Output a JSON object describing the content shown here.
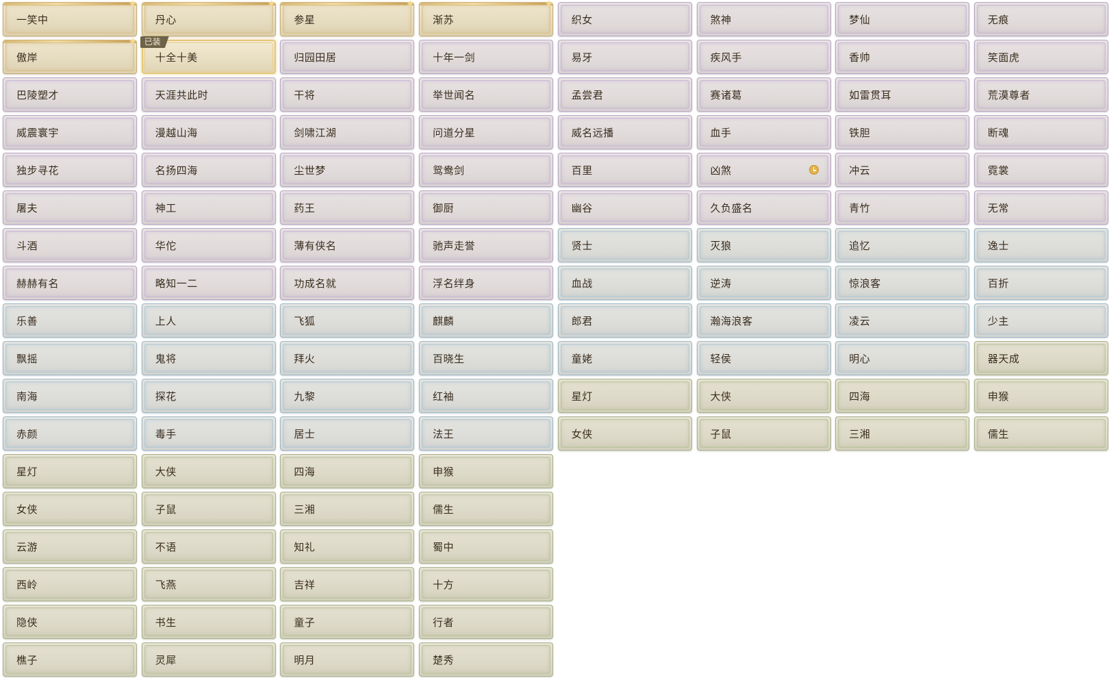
{
  "equipped_badge": "已装",
  "colors": {
    "gold": "#e6dcc0",
    "purple": "#e0dbda",
    "blue": "#dcdcd8",
    "green": "#ddd9c8",
    "text": "#3a2d1e"
  },
  "titles": [
    [
      "一笑中",
      "丹心",
      "参星",
      "渐苏",
      "织女",
      "煞神",
      "梦仙",
      "无痕"
    ],
    [
      "傲岸",
      "十全十美",
      "归园田居",
      "十年一剑",
      "易牙",
      "疾风手",
      "香帅",
      "笑面虎"
    ],
    [
      "巴陵塑才",
      "天涯共此时",
      "干将",
      "举世闻名",
      "孟尝君",
      "赛诸葛",
      "如雷贯耳",
      "荒漠尊者"
    ],
    [
      "威震寰宇",
      "漫越山海",
      "剑啸江湖",
      "问道分星",
      "威名远播",
      "血手",
      "铁胆",
      "断魂"
    ],
    [
      "独步寻花",
      "名扬四海",
      "尘世梦",
      "鸳鸯剑",
      "百里",
      "凶煞",
      "冲云",
      "霓裳"
    ],
    [
      "屠夫",
      "神工",
      "药王",
      "御厨",
      "幽谷",
      "久负盛名",
      "青竹",
      "无常"
    ],
    [
      "斗酒",
      "华佗",
      "薄有侠名",
      "驰声走誉",
      "贤士",
      "灭狼",
      "追忆",
      "逸士"
    ],
    [
      "赫赫有名",
      "略知一二",
      "功成名就",
      "浮名绊身",
      "血战",
      "逆涛",
      "惊浪客",
      "百折"
    ],
    [
      "乐善",
      "上人",
      "飞狐",
      "麒麟",
      "郎君",
      "瀚海浪客",
      "凌云",
      "少主"
    ],
    [
      "飘摇",
      "鬼将",
      "拜火",
      "百晓生",
      "童姥",
      "轻侯",
      "明心",
      "器天成"
    ],
    [
      "南海",
      "探花",
      "九黎",
      "红袖",
      "星灯",
      "大侠",
      "四海",
      "申猴"
    ],
    [
      "赤颜",
      "毒手",
      "居士",
      "法王",
      "女侠",
      "子鼠",
      "三湘",
      "儒生"
    ],
    [
      "星灯",
      "大侠",
      "四海",
      "申猴"
    ],
    [
      "女侠",
      "子鼠",
      "三湘",
      "儒生"
    ],
    [
      "云游",
      "不语",
      "知礼",
      "蜀中"
    ],
    [
      "西岭",
      "飞燕",
      "吉祥",
      "十方"
    ],
    [
      "隐侠",
      "书生",
      "童子",
      "行者"
    ],
    [
      "樵子",
      "灵犀",
      "明月",
      "楚秀"
    ]
  ],
  "rarity": [
    [
      "gold",
      "gold",
      "gold",
      "gold",
      "purple",
      "purple",
      "purple",
      "purple"
    ],
    [
      "gold",
      "gold-eq",
      "purple",
      "purple",
      "purple",
      "purple",
      "purple",
      "purple"
    ],
    [
      "purple",
      "purple",
      "purple",
      "purple",
      "purple",
      "purple",
      "purple",
      "purple"
    ],
    [
      "purple",
      "purple",
      "purple",
      "purple",
      "purple",
      "purple",
      "purple",
      "purple"
    ],
    [
      "purple",
      "purple",
      "purple",
      "purple",
      "purple",
      "purple",
      "purple",
      "purple"
    ],
    [
      "purple",
      "purple",
      "purple",
      "purple",
      "purple",
      "purple",
      "purple",
      "purple"
    ],
    [
      "purple",
      "purple",
      "purple",
      "purple",
      "blue",
      "blue",
      "blue",
      "blue"
    ],
    [
      "purple",
      "purple",
      "purple",
      "purple",
      "blue",
      "blue",
      "blue",
      "blue"
    ],
    [
      "blue",
      "blue",
      "blue",
      "blue",
      "blue",
      "blue",
      "blue",
      "blue"
    ],
    [
      "blue",
      "blue",
      "blue",
      "blue",
      "blue",
      "blue",
      "blue",
      "green"
    ],
    [
      "blue",
      "blue",
      "blue",
      "blue",
      "green",
      "green",
      "green",
      "green"
    ],
    [
      "blue",
      "blue",
      "blue",
      "blue",
      "green",
      "green",
      "green",
      "green"
    ],
    [
      "green",
      "green",
      "green",
      "green"
    ],
    [
      "green",
      "green",
      "green",
      "green"
    ],
    [
      "green",
      "green",
      "green",
      "green"
    ],
    [
      "green",
      "green",
      "green",
      "green"
    ],
    [
      "green",
      "green",
      "green",
      "green"
    ],
    [
      "green",
      "green",
      "green",
      "green"
    ]
  ],
  "sparkles": [
    [
      0,
      0
    ],
    [
      0,
      1
    ],
    [
      0,
      2
    ],
    [
      0,
      3
    ],
    [
      1,
      0
    ]
  ],
  "equipped": [
    1,
    1
  ],
  "timed": [
    4,
    5
  ]
}
